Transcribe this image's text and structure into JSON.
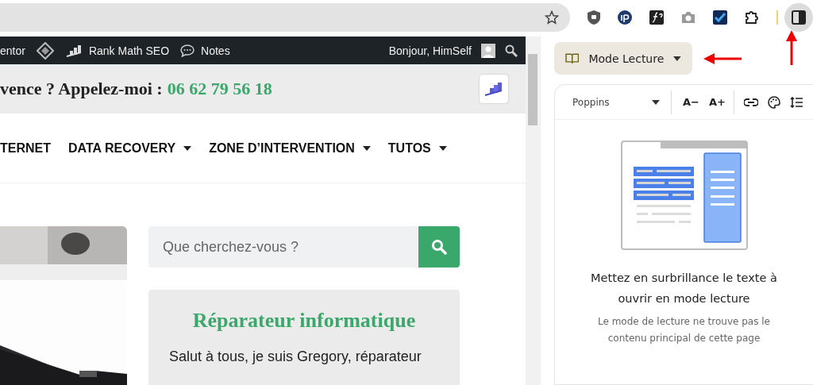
{
  "browser": {
    "side_panel_button": {
      "selected": true
    }
  },
  "admin_bar": {
    "items": [
      {
        "kind": "text",
        "label": "entor"
      },
      {
        "kind": "diamond"
      },
      {
        "kind": "rankmath",
        "label": "Rank Math SEO"
      },
      {
        "kind": "notes",
        "label": "Notes"
      }
    ],
    "greeting": "Bonjour, HimSelf"
  },
  "header": {
    "text": "vence ? Appelez-moi :",
    "phone": "06 62 79 56 18"
  },
  "nav": [
    {
      "label": "TERNET",
      "dropdown": false
    },
    {
      "label": "DATA RECOVERY",
      "dropdown": true
    },
    {
      "label": "ZONE D’INTERVENTION",
      "dropdown": true
    },
    {
      "label": "TUTOS",
      "dropdown": true
    }
  ],
  "search": {
    "placeholder": "Que cherchez-vous ?"
  },
  "widget": {
    "title": "Réparateur informatique",
    "text": "Salut à tous, je suis Gregory, réparateur"
  },
  "side_panel": {
    "mode_button": "Mode Lecture",
    "font": "Poppins",
    "font_smaller": "A−",
    "font_larger": "A+",
    "heading": "Mettez en surbrillance le texte à ouvrir en mode lecture",
    "message": "Le mode de lecture ne trouve pas le contenu principal de cette page"
  }
}
